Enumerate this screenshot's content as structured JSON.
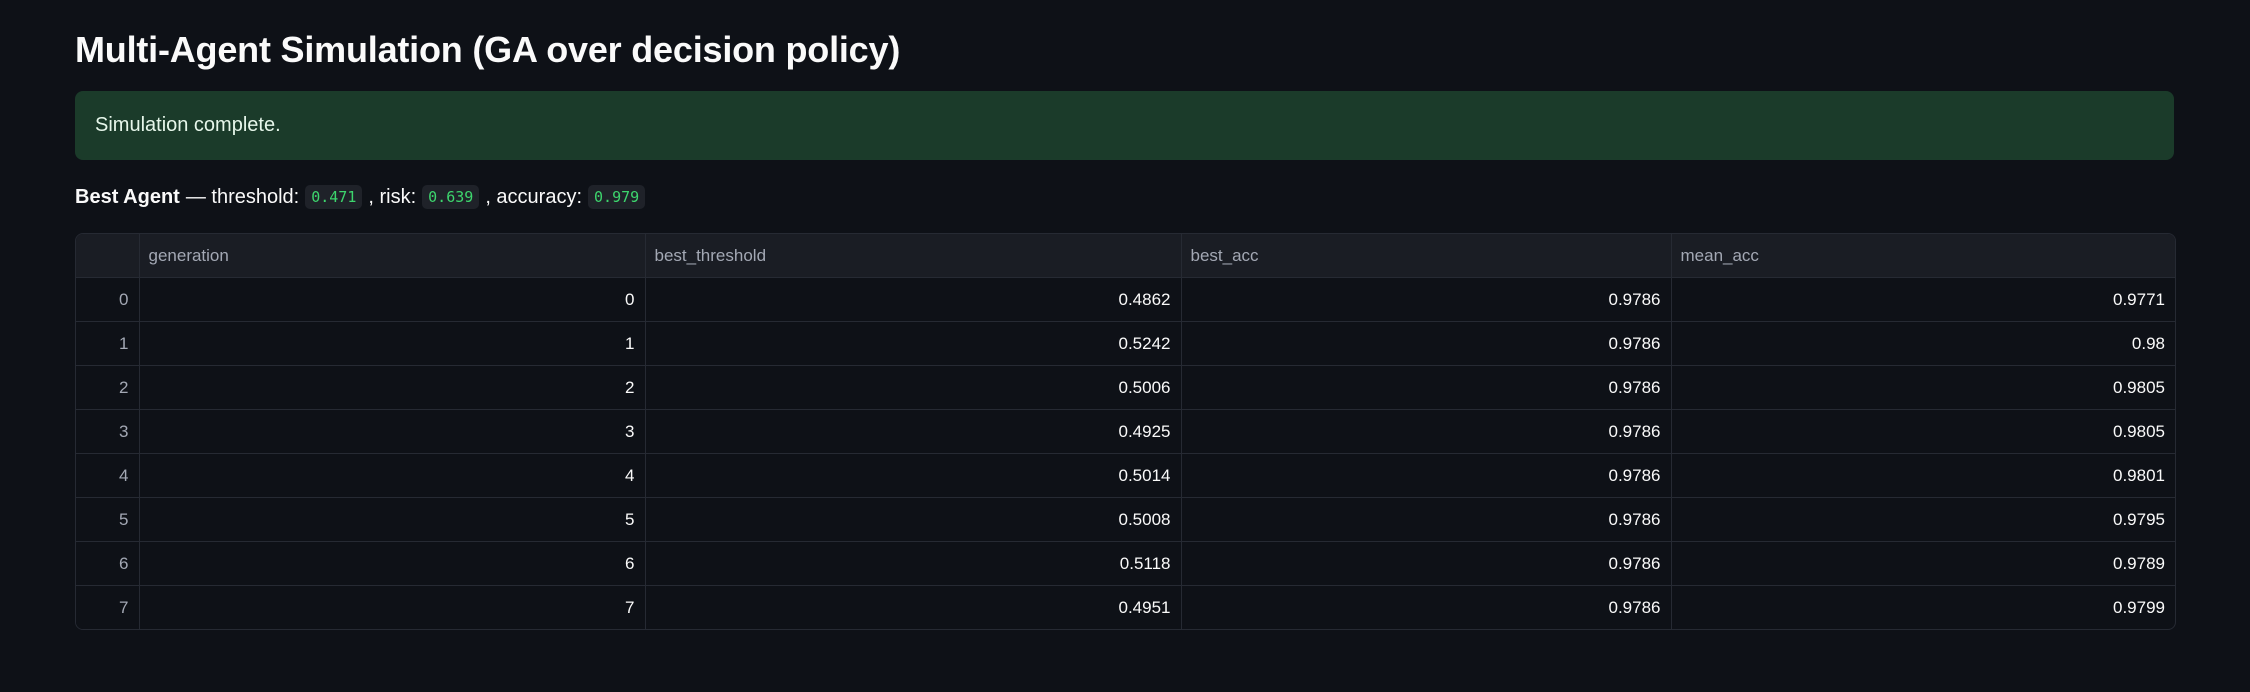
{
  "page": {
    "title": "Multi-Agent Simulation (GA over decision policy)"
  },
  "alert": {
    "message": "Simulation complete."
  },
  "summary": {
    "label_bold": "Best Agent",
    "threshold_label": "— threshold:",
    "threshold_value": "0.471",
    "risk_label": ", risk:",
    "risk_value": "0.639",
    "accuracy_label": ", accuracy:",
    "accuracy_value": "0.979"
  },
  "table": {
    "columns": [
      "",
      "generation",
      "best_threshold",
      "best_acc",
      "mean_acc"
    ],
    "rows": [
      [
        "0",
        "0",
        "0.4862",
        "0.9786",
        "0.9771"
      ],
      [
        "1",
        "1",
        "0.5242",
        "0.9786",
        "0.98"
      ],
      [
        "2",
        "2",
        "0.5006",
        "0.9786",
        "0.9805"
      ],
      [
        "3",
        "3",
        "0.4925",
        "0.9786",
        "0.9805"
      ],
      [
        "4",
        "4",
        "0.5014",
        "0.9786",
        "0.9801"
      ],
      [
        "5",
        "5",
        "0.5008",
        "0.9786",
        "0.9795"
      ],
      [
        "6",
        "6",
        "0.5118",
        "0.9786",
        "0.9789"
      ],
      [
        "7",
        "7",
        "0.4951",
        "0.9786",
        "0.9799"
      ]
    ]
  },
  "colors": {
    "background": "#0e1117",
    "success_bg": "#1b3b2a",
    "code_green": "#3dd56d"
  }
}
